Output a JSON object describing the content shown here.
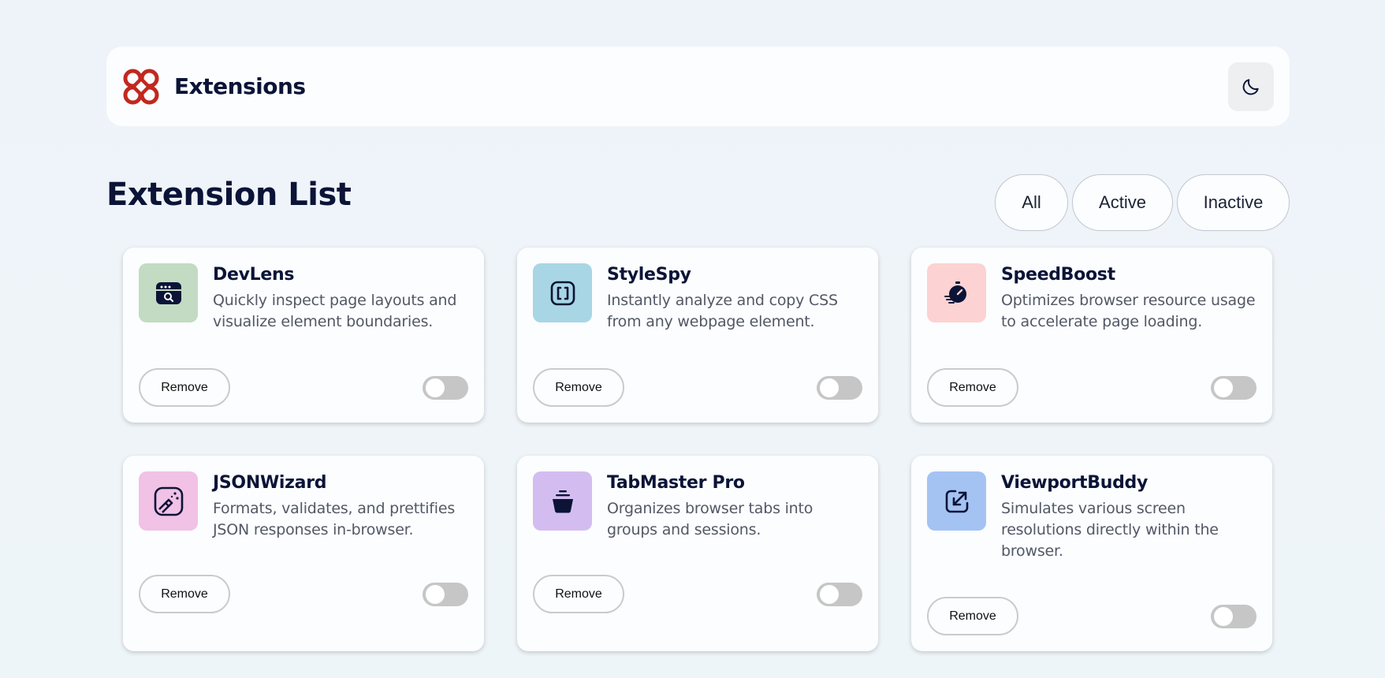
{
  "header": {
    "brand_name": "Extensions",
    "logo_color": "#c2281f",
    "theme_toggle_icon": "moon-icon"
  },
  "page_title": "Extension List",
  "filters": [
    {
      "label": "All"
    },
    {
      "label": "Active"
    },
    {
      "label": "Inactive"
    }
  ],
  "extensions": [
    {
      "name": "DevLens",
      "description": "Quickly inspect page layouts and visualize element boundaries.",
      "icon": "browser-search-icon",
      "icon_bg": "#c2dbc2",
      "remove_label": "Remove",
      "enabled": false
    },
    {
      "name": "StyleSpy",
      "description": "Instantly analyze and copy CSS from any webpage element.",
      "icon": "brackets-icon",
      "icon_bg": "#a8d6e4",
      "remove_label": "Remove",
      "enabled": false
    },
    {
      "name": "SpeedBoost",
      "description": "Optimizes browser resource usage to accelerate page loading.",
      "icon": "stopwatch-icon",
      "icon_bg": "#fdd2d2",
      "remove_label": "Remove",
      "enabled": false
    },
    {
      "name": "JSONWizard",
      "description": "Formats, validates, and prettifies JSON responses in-browser.",
      "icon": "wand-icon",
      "icon_bg": "#f1c1e6",
      "remove_label": "Remove",
      "enabled": false
    },
    {
      "name": "TabMaster Pro",
      "description": "Organizes browser tabs into groups and sessions.",
      "icon": "jar-icon",
      "icon_bg": "#d3bdf0",
      "remove_label": "Remove",
      "enabled": false
    },
    {
      "name": "ViewportBuddy",
      "description": "Simulates various screen resolutions directly within the browser.",
      "icon": "resize-arrow-icon",
      "icon_bg": "#a4c3f3",
      "remove_label": "Remove",
      "enabled": false
    }
  ]
}
